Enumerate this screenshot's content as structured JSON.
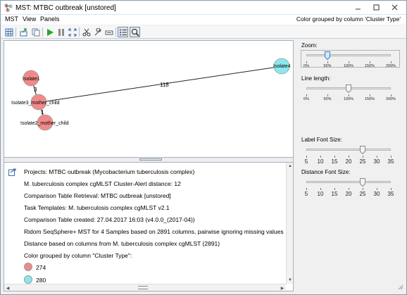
{
  "window": {
    "title": "MST: MTBC outbreak [unstored]"
  },
  "menu": {
    "items": [
      "MST",
      "View",
      "Panels"
    ],
    "status": "Color grouped by column 'Cluster Type'"
  },
  "graph": {
    "nodes": [
      {
        "label": "Isolate1",
        "color": "#f08a8a"
      },
      {
        "label": "Isolate3_mother_child",
        "color": "#f08a8a"
      },
      {
        "label": "Isolate2_mother_child",
        "color": "#f08a8a"
      },
      {
        "label": "Isolate4",
        "color": "#8ae8ee"
      }
    ],
    "edges": [
      {
        "from": "Isolate1",
        "to": "Isolate3_mother_child",
        "distance": "3"
      },
      {
        "from": "Isolate3_mother_child",
        "to": "Isolate2_mother_child",
        "distance": "1"
      },
      {
        "from": "Isolate3_mother_child",
        "to": "Isolate4",
        "distance": "118"
      }
    ]
  },
  "info": {
    "lines": [
      "Projects: MTBC outbreak (Mycobacterium tuberculosis complex)",
      "M. tuberculosis complex cgMLST Cluster-Alert distance: 12",
      "Comparison Table Retrieval: MTBC outbreak [unstored]",
      "Task Templates: M. tuberculosis complex cgMLST v2.1",
      "Comparison Table created: 27.04.2017 16:03 (v4.0.0_(2017-04))",
      "Ridom SeqSphere+ MST for 4 Samples based on 2891 columns, pairwise ignoring missing values",
      "Distance based on columns from M. tuberculosis complex cgMLST (2891)",
      "Color grouped by column \"Cluster Type\":"
    ],
    "legend": [
      {
        "label": "274",
        "color": "#f08a8a"
      },
      {
        "label": "280",
        "color": "#8ae8ee"
      }
    ]
  },
  "panel": {
    "zoom": {
      "label": "Zoom:",
      "ticks": [
        "0%",
        "50%",
        "100%",
        "150%",
        "200%"
      ],
      "value_percent": 50
    },
    "line_length": {
      "label": "Line length:",
      "ticks": [
        "0%",
        "50%",
        "100%",
        "150%",
        "200%"
      ],
      "value_percent": 100
    },
    "label_font": {
      "label": "Label Font Size:",
      "ticks": [
        "5",
        "10",
        "15",
        "20",
        "25",
        "30",
        "35"
      ],
      "value": 25
    },
    "distance_font": {
      "label": "Distance Font Size:",
      "ticks": [
        "5",
        "10",
        "15",
        "20",
        "25",
        "30",
        "35"
      ],
      "value": 25
    }
  },
  "colors": {
    "accent": "#3c7fc4",
    "node_red": "#f08a8a",
    "node_cyan": "#8ae8ee"
  }
}
